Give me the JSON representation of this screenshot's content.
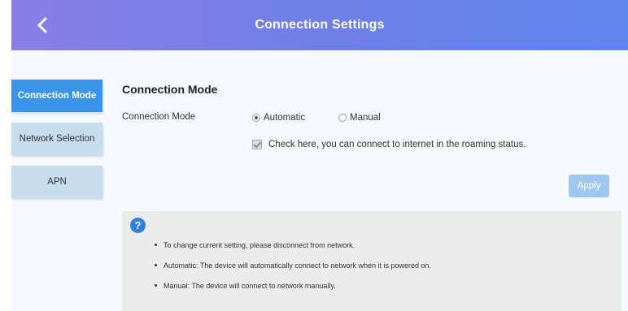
{
  "header": {
    "title": "Connection Settings",
    "back_icon": "chevron-left-icon"
  },
  "sidebar": {
    "items": [
      {
        "label": "Connection Mode",
        "active": true
      },
      {
        "label": "Network Selection",
        "active": false
      },
      {
        "label": "APN",
        "active": false
      }
    ]
  },
  "main": {
    "section_title": "Connection Mode",
    "field_label": "Connection Mode",
    "radio_options": [
      {
        "label": "Automatic",
        "checked": true
      },
      {
        "label": "Manual",
        "checked": false
      }
    ],
    "roaming_checkbox": {
      "label": "Check here, you can connect to internet in the roaming status.",
      "checked": true
    },
    "apply_label": "Apply"
  },
  "help": {
    "icon": "question-icon",
    "icon_glyph": "?",
    "items": [
      "To change current setting, please disconnect from network.",
      "Automatic: The device will automatically connect to network when it is powered on.",
      "Manual: The device will connect to network manually."
    ]
  },
  "colors": {
    "accent": "#3a95e8",
    "header_start": "#8a7ee6",
    "header_end": "#5f86ec",
    "apply_disabled": "#9fc7ef"
  }
}
